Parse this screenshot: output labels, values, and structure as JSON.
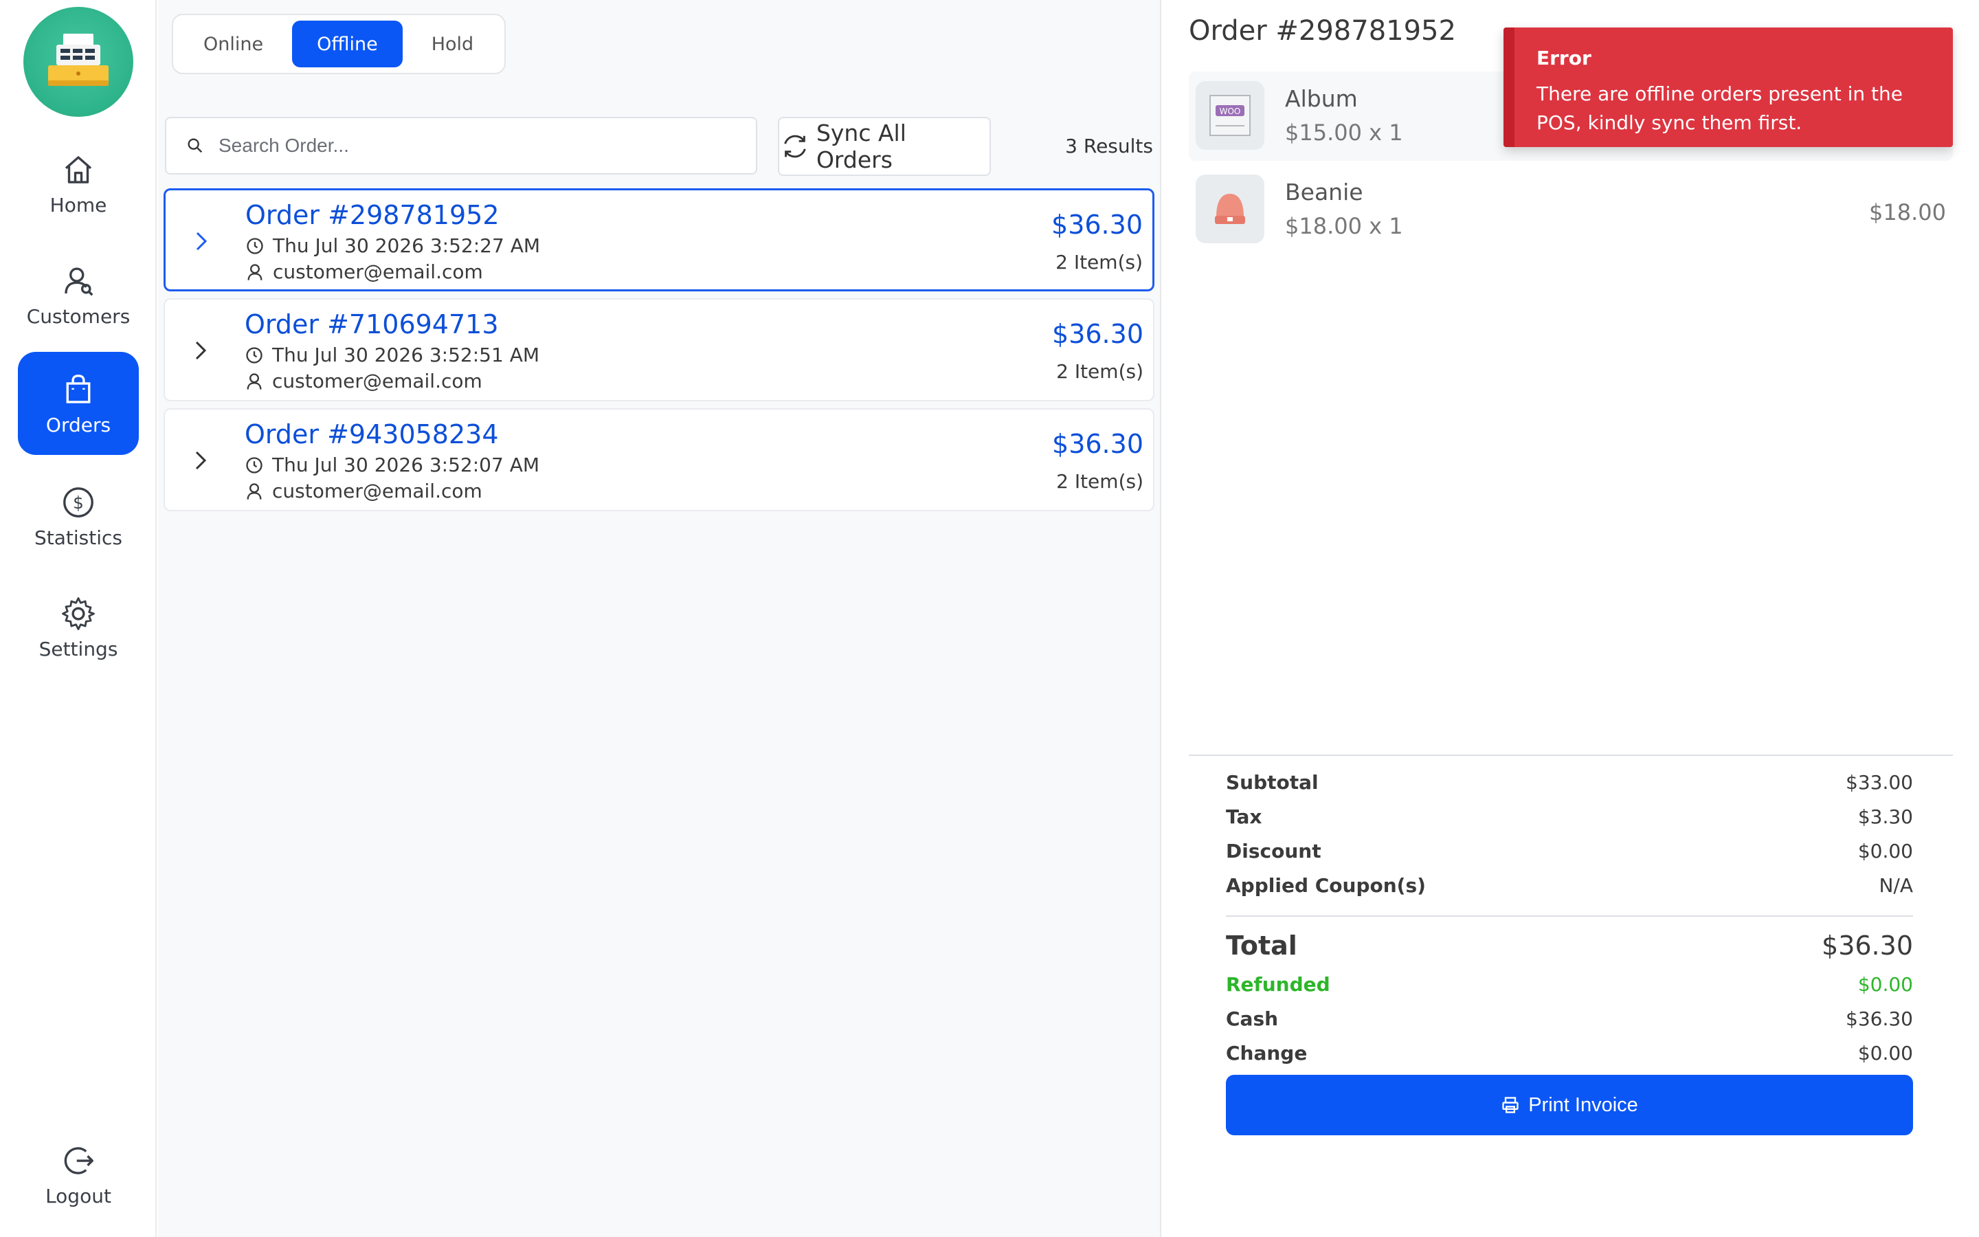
{
  "sidebar": {
    "items": [
      {
        "label": "Home",
        "icon": "home-icon"
      },
      {
        "label": "Customers",
        "icon": "customers-icon"
      },
      {
        "label": "Orders",
        "icon": "orders-bag-icon",
        "active": true
      },
      {
        "label": "Statistics",
        "icon": "dollar-circle-icon"
      },
      {
        "label": "Settings",
        "icon": "gear-icon"
      }
    ],
    "logout_label": "Logout"
  },
  "tabs": {
    "online": "Online",
    "offline": "Offline",
    "hold": "Hold",
    "active": "Offline"
  },
  "search": {
    "placeholder": "Search Order...",
    "value": ""
  },
  "toolbar": {
    "sync_label": "Sync All Orders",
    "results_text": "3 Results"
  },
  "orders": [
    {
      "id": "Order #298781952",
      "datetime": "Thu Jul 30 2026 3:52:27 AM",
      "email": "customer@email.com",
      "amount": "$36.30",
      "items": "2 Item(s)",
      "selected": true
    },
    {
      "id": "Order #710694713",
      "datetime": "Thu Jul 30 2026 3:52:51 AM",
      "email": "customer@email.com",
      "amount": "$36.30",
      "items": "2 Item(s)",
      "selected": false
    },
    {
      "id": "Order #943058234",
      "datetime": "Thu Jul 30 2026 3:52:07 AM",
      "email": "customer@email.com",
      "amount": "$36.30",
      "items": "2 Item(s)",
      "selected": false
    }
  ],
  "detail": {
    "title": "Order #298781952",
    "line_items": [
      {
        "name": "Album",
        "qty_text": "$15.00 x 1",
        "total": ""
      },
      {
        "name": "Beanie",
        "qty_text": "$18.00 x 1",
        "total": "$18.00"
      }
    ],
    "summary": {
      "subtotal_label": "Subtotal",
      "subtotal": "$33.00",
      "tax_label": "Tax",
      "tax": "$3.30",
      "discount_label": "Discount",
      "discount": "$0.00",
      "coupon_label": "Applied Coupon(s)",
      "coupon": "N/A",
      "total_label": "Total",
      "total": "$36.30",
      "refunded_label": "Refunded",
      "refunded": "$0.00",
      "cash_label": "Cash",
      "cash": "$36.30",
      "change_label": "Change",
      "change": "$0.00"
    },
    "print_label": "Print Invoice"
  },
  "toast": {
    "title": "Error",
    "message": "There are offline orders present in the POS, kindly sync them first."
  },
  "colors": {
    "accent": "#0b57f5",
    "order_link": "#0d4fd8",
    "error": "#dc3540",
    "success": "#2db62a",
    "logo": "#2db389"
  }
}
